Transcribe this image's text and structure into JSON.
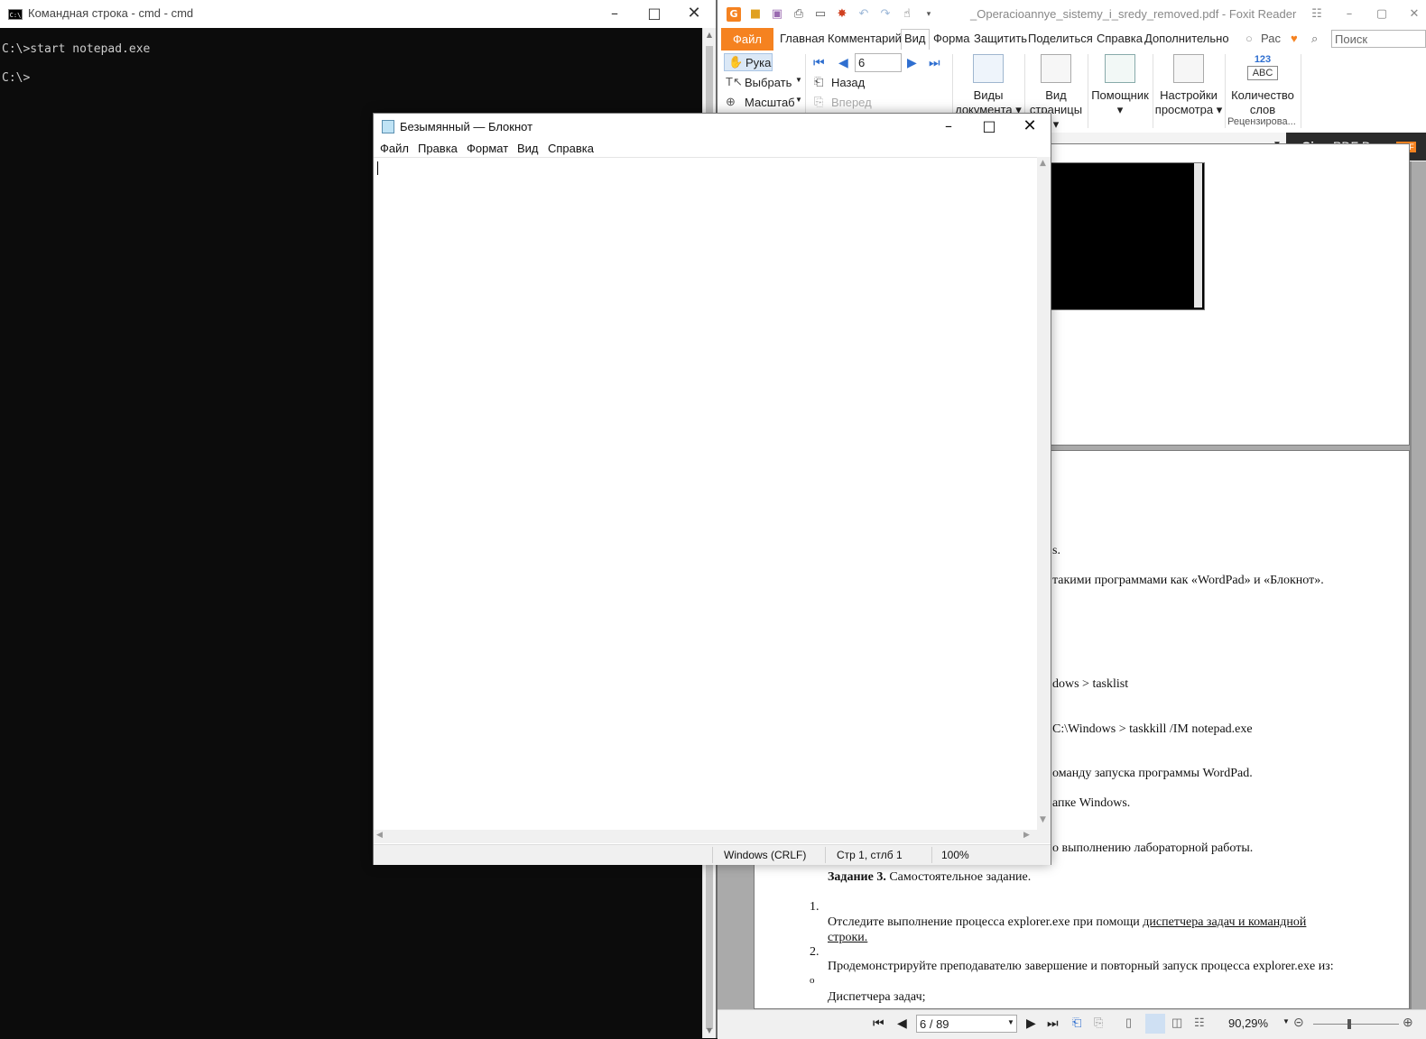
{
  "cmd": {
    "title": "Командная строка - cmd - cmd",
    "icon_text": "C:\\",
    "lines": [
      "C:\\>start notepad.exe",
      "C:\\>"
    ]
  },
  "foxit": {
    "doc_title": "_Operacioannye_sistemy_i_sredy_removed.pdf - Foxit Reader",
    "tabs": {
      "file": "Файл",
      "home": "Главная",
      "comment": "Комментарий",
      "view": "Вид",
      "form": "Форма",
      "protect": "Защитить",
      "share": "Поделиться",
      "help": "Справка",
      "extra": "Дополнительно"
    },
    "tell_me": "Рас",
    "search_placeholder": "Поиск",
    "ribbon": {
      "hand": "Рука",
      "select": "Выбрать",
      "zoom": "Масштаб",
      "page_input": "6",
      "back": "Назад",
      "forward": "Вперед",
      "doc_views": [
        "Виды",
        "документа"
      ],
      "page_view": [
        "Вид",
        "страницы"
      ],
      "assistant": "Помощник",
      "view_settings": [
        "Настройки",
        "просмотра"
      ],
      "word_count": [
        "Количество",
        "слов"
      ],
      "word_count_icon": [
        "123",
        "ABC"
      ],
      "review_group": "Рецензирова..."
    },
    "esign": {
      "bold": "eSign",
      "rest": "PDF Docs",
      "badge": "PDF"
    },
    "page_lines": {
      "l1": "s.",
      "l2": " такими программами как «WordPad» и «Блокнот».",
      "l3": "dows > tasklist",
      "l4": "C:\\Windows > taskkill /IM notepad.exe",
      "l5": "оманду запуска программы WordPad.",
      "l6": "апке Windows.",
      "l7": "о выполнению лабораторной работы.",
      "task3_bold": "Задание 3.",
      "task3_rest": " Самостоятельное задание.",
      "n1": "1.",
      "item1_a": "Отследите выполнение процесса explorer.exe при помощи ",
      "item1_link": "диспетчера задач и командной ",
      "item1_link2": "строки.",
      "n2": "2.",
      "item2": "Продемонстрируйте преподавателю завершение и повторный запуск процесса explorer.exe из:",
      "bullet": "o",
      "sub1": "Диспетчера задач;"
    },
    "status": {
      "page": "6 / 89",
      "zoom": "90,29%"
    }
  },
  "notepad": {
    "title": "Безымянный — Блокнот",
    "menu": [
      "Файл",
      "Правка",
      "Формат",
      "Вид",
      "Справка"
    ],
    "text": "",
    "status": {
      "line_ending": "Windows (CRLF)",
      "position": "Стр 1, стлб 1",
      "zoom": "100%"
    }
  }
}
